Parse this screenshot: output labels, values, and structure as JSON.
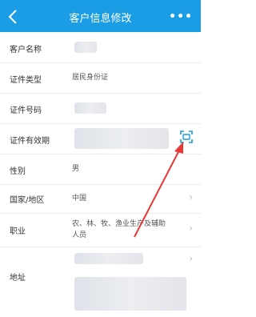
{
  "header": {
    "title": "客户信息修改",
    "more_label": "•••"
  },
  "form": {
    "rows": [
      {
        "label": "客户名称",
        "value": ""
      },
      {
        "label": "证件类型",
        "value": "居民身份证"
      },
      {
        "label": "证件号码",
        "value": ""
      },
      {
        "label": "证件有效期",
        "value": ""
      },
      {
        "label": "性别",
        "value": "男"
      },
      {
        "label": "国家/地区",
        "value": "中国"
      },
      {
        "label": "职业",
        "value": "农、林、牧、渔业生产及辅助人员"
      },
      {
        "label": "地址",
        "value": ""
      }
    ]
  },
  "colors": {
    "accent": "#1a9de5",
    "annotation_arrow": "#e53935"
  },
  "icons": {
    "back": "chevron-left-icon",
    "scan": "scan-id-icon",
    "chevron": "chevron-right-icon"
  }
}
